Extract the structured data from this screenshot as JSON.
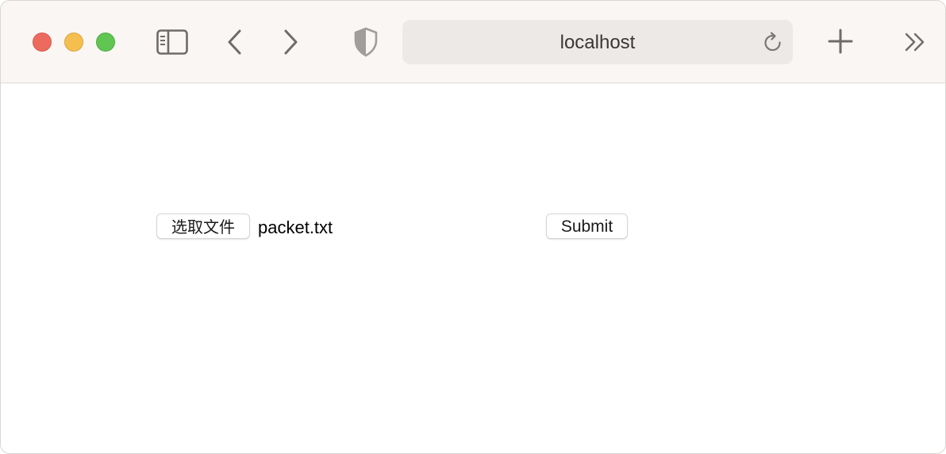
{
  "browser": {
    "address": "localhost",
    "icons": {
      "sidebar": "sidebar-icon",
      "back": "chevron-left-icon",
      "forward": "chevron-right-icon",
      "privacy": "shield-icon",
      "reload": "reload-icon",
      "new_tab": "plus-icon",
      "overflow": "chevron-double-right-icon"
    },
    "traffic_colors": {
      "close": "#ed6a5e",
      "minimize": "#f5bf4f",
      "maximize": "#61c554"
    }
  },
  "form": {
    "file_button_label": "选取文件",
    "file_name": "packet.txt",
    "submit_label": "Submit"
  }
}
